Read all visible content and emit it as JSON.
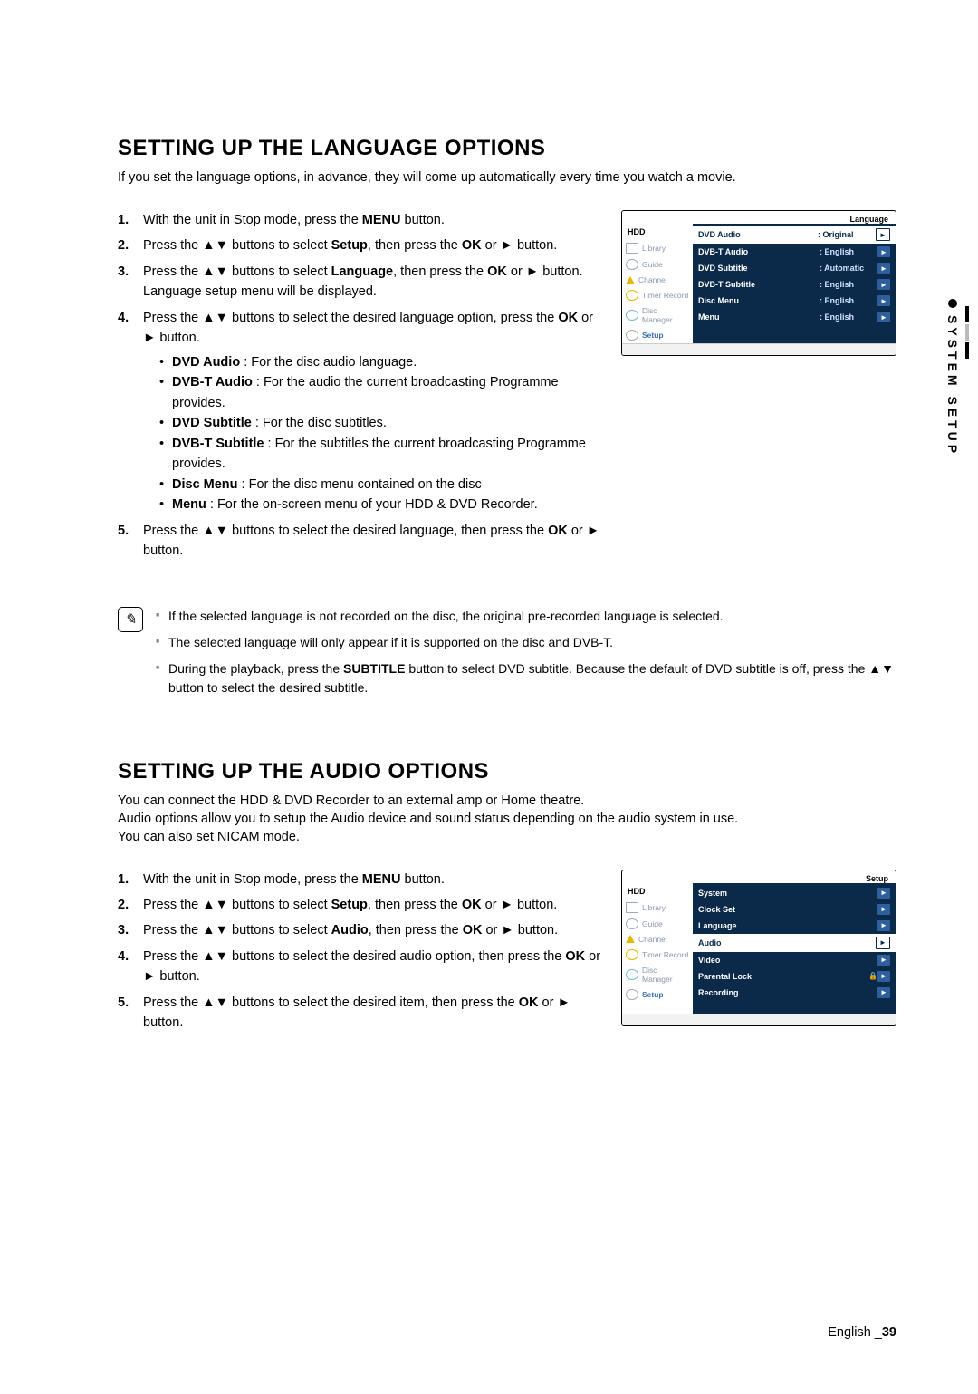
{
  "sidebar": {
    "label": "SYSTEM SETUP"
  },
  "footer": {
    "lang": "English",
    "page": "39"
  },
  "s1": {
    "heading": "SETTING UP THE LANGUAGE OPTIONS",
    "intro": "If you set the language options, in advance, they will come up automatically every time you watch a movie.",
    "steps": {
      "n1a": "With the unit in Stop mode, press the ",
      "n1b": "MENU",
      "n1c": " button.",
      "n2a": "Press the ▲▼ buttons to select ",
      "n2b": "Setup",
      "n2c": ", then press the ",
      "n2d": "OK",
      "n2e": " or ► button.",
      "n3a": "Press the ▲▼ buttons to select ",
      "n3b": "Language",
      "n3c": ", then press the ",
      "n3d": "OK",
      "n3e": " or ► button.",
      "n3f": "Language setup menu will be displayed.",
      "n4a": "Press the ▲▼ buttons to select the desired language option, press the ",
      "n4b": "OK",
      "n4c": " or ► button.",
      "b1a": "DVD Audio",
      "b1b": " : For the disc audio language.",
      "b2a": "DVB-T Audio",
      "b2b": " : For the audio the current broadcasting Programme provides.",
      "b3a": "DVD Subtitle",
      "b3b": " : For the disc subtitles.",
      "b4a": "DVB-T Subtitle",
      "b4b": " : For the subtitles the current broadcasting Programme provides.",
      "b5a": "Disc Menu",
      "b5b": " : For the disc menu contained on the disc",
      "b6a": "Menu",
      "b6b": " : For the on-screen menu of your HDD & DVD Recorder.",
      "n5a": "Press the ▲▼ buttons to select the desired language, then press the ",
      "n5b": "OK",
      "n5c": " or ► button."
    },
    "notes": {
      "n1": "If the selected language is not recorded on the disc, the original pre-recorded language is selected.",
      "n2": "The selected language will only appear if it is supported on the disc and DVB-T.",
      "n3a": "During the playback, press the ",
      "n3b": "SUBTITLE",
      "n3c": " button to select DVD subtitle. Because the default of DVD subtitle is off, press the ▲▼ button to select the desired subtitle."
    },
    "osd": {
      "title": "Language",
      "hdd": "HDD",
      "side": [
        "Library",
        "Guide",
        "Channel",
        "Timer Record",
        "Disc Manager",
        "Setup"
      ],
      "rows": [
        {
          "k": "DVD Audio",
          "v": ": Original",
          "hl": true
        },
        {
          "k": "DVB-T Audio",
          "v": ": English"
        },
        {
          "k": "DVD Subtitle",
          "v": ": Automatic"
        },
        {
          "k": "DVB-T Subtitle",
          "v": ": English"
        },
        {
          "k": "Disc Menu",
          "v": ": English"
        },
        {
          "k": "Menu",
          "v": ": English"
        }
      ]
    }
  },
  "s2": {
    "heading": "SETTING UP THE AUDIO OPTIONS",
    "intro1": "You can connect the HDD & DVD Recorder to an external amp or Home theatre.",
    "intro2": "Audio options allow you to setup the Audio device and sound status depending on the audio system in use.",
    "intro3": "You can also set NICAM mode.",
    "steps": {
      "n1a": "With the unit in Stop mode, press the ",
      "n1b": "MENU",
      "n1c": " button.",
      "n2a": "Press the ▲▼ buttons to select ",
      "n2b": "Setup",
      "n2c": ", then press the ",
      "n2d": "OK",
      "n2e": " or ► button.",
      "n3a": "Press the ▲▼ buttons to select ",
      "n3b": "Audio",
      "n3c": ", then press the ",
      "n3d": "OK",
      "n3e": " or ► button.",
      "n4a": "Press the ▲▼ buttons to select the desired audio option, then press the ",
      "n4b": "OK",
      "n4c": " or ► button.",
      "n5a": "Press the ▲▼ buttons to select the desired item, then press the ",
      "n5b": "OK",
      "n5c": " or ► button."
    },
    "osd": {
      "title": "Setup",
      "hdd": "HDD",
      "side": [
        "Library",
        "Guide",
        "Channel",
        "Timer Record",
        "Disc Manager",
        "Setup"
      ],
      "rows": [
        {
          "k": "System"
        },
        {
          "k": "Clock Set"
        },
        {
          "k": "Language"
        },
        {
          "k": "Audio",
          "hl": true
        },
        {
          "k": "Video"
        },
        {
          "k": "Parental Lock",
          "lock": true
        },
        {
          "k": "Recording"
        }
      ]
    }
  }
}
